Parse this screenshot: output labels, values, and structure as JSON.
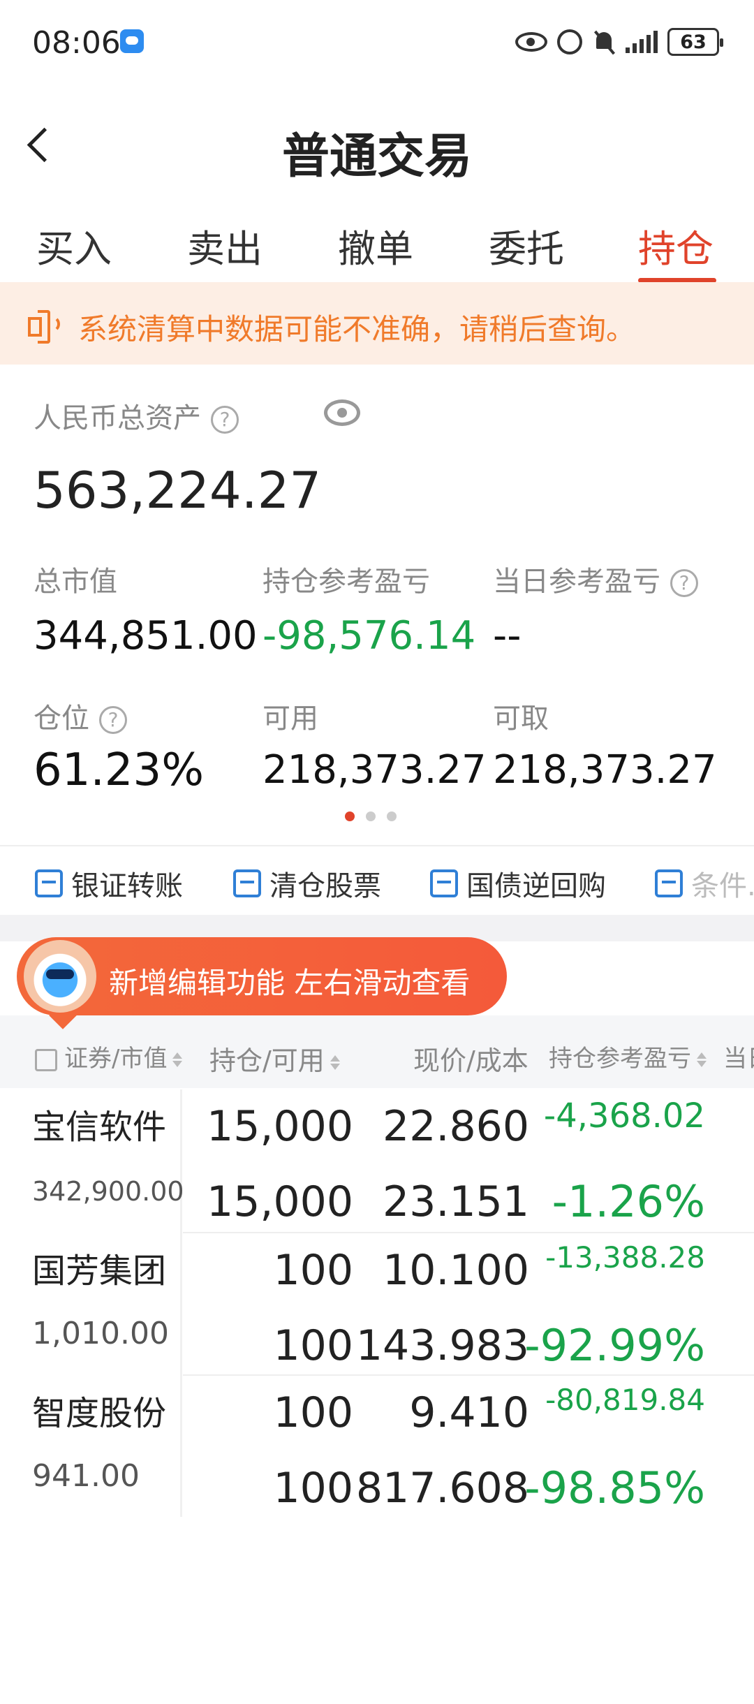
{
  "status_bar": {
    "time": "08:06",
    "battery": "63"
  },
  "header": {
    "title": "普通交易"
  },
  "tabs": [
    {
      "label": "买入"
    },
    {
      "label": "卖出"
    },
    {
      "label": "撤单"
    },
    {
      "label": "委托"
    },
    {
      "label": "持仓",
      "active": true
    }
  ],
  "notice": {
    "text": "系统清算中数据可能不准确，请稍后查询。"
  },
  "assets": {
    "total_label": "人民币总资产",
    "total_value": "563,224.27",
    "market_value_label": "总市值",
    "market_value": "344,851.00",
    "position_pl_label": "持仓参考盈亏",
    "position_pl": "-98,576.14",
    "daily_pl_label": "当日参考盈亏",
    "daily_pl": "--",
    "position_ratio_label": "仓位",
    "position_ratio": "61.23%",
    "available_label": "可用",
    "available": "218,373.27",
    "withdrawable_label": "可取",
    "withdrawable": "218,373.27"
  },
  "quick_actions": [
    {
      "label": "银证转账"
    },
    {
      "label": "清仓股票"
    },
    {
      "label": "国债逆回购"
    },
    {
      "label": "条件..."
    }
  ],
  "promo": {
    "text": "新增编辑功能 左右滑动查看"
  },
  "table": {
    "headers": {
      "security": "证券/市值",
      "holding": "持仓/可用",
      "price": "现价/成本",
      "pl": "持仓参考盈亏",
      "daily": "当日"
    },
    "rows": [
      {
        "name": "宝信软件",
        "market_value": "342,900.00",
        "holding": "15,000",
        "available": "15,000",
        "price": "22.860",
        "cost": "23.151",
        "pl": "-4,368.02",
        "pl_pct": "-1.26%"
      },
      {
        "name": "国芳集团",
        "market_value": "1,010.00",
        "holding": "100",
        "available": "100",
        "price": "10.100",
        "cost": "143.983",
        "pl": "-13,388.28",
        "pl_pct": "-92.99%"
      },
      {
        "name": "智度股份",
        "market_value": "941.00",
        "holding": "100",
        "available": "100",
        "price": "9.410",
        "cost": "817.608",
        "pl": "-80,819.84",
        "pl_pct": "-98.85%"
      }
    ]
  },
  "colors": {
    "accent": "#e0432b",
    "notice": "#f07a2a",
    "loss": "#1aa34a",
    "action_icon": "#2f7fd6"
  }
}
